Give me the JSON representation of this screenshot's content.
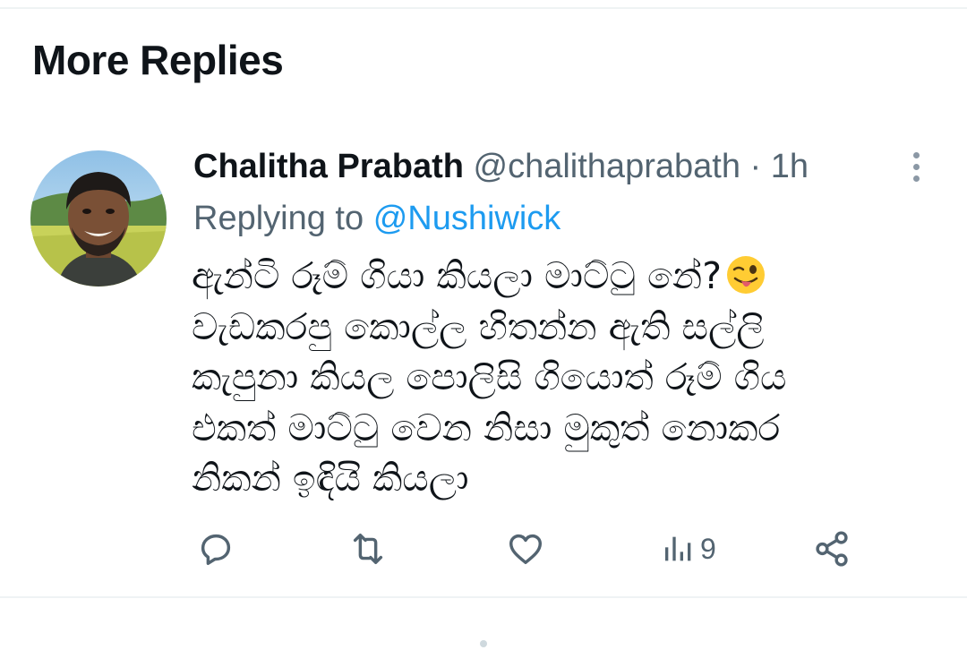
{
  "section": {
    "title": "More Replies"
  },
  "reply": {
    "author_name": "Chalitha Prabath",
    "author_handle": "@chalithaprabath",
    "separator": "·",
    "timestamp": "1h",
    "replying_prefix": "Replying to",
    "replying_to": "@Nushiwick",
    "body_lines": [
      "ඇන්ටි රූම් ගියා කියලා මාට්ටු නේ?",
      "වැඩකරපු කොල්ල හිතන්න ඇති සල්ලි",
      "කැපුනා කියල පොලිසි ගියොත් රූම් ගිය",
      "එකත් මාට්ටු වෙන නිසා මුකුත් නොකර",
      "නිකන් ඉඳියි කියලා"
    ],
    "emoji": "winking-face-with-tongue",
    "views_count": "9"
  },
  "icons": {
    "reply": "reply-bubble-icon",
    "retweet": "retweet-icon",
    "like": "heart-icon",
    "views": "views-bar-chart-icon",
    "share": "share-nodes-icon",
    "more": "more-vertical-icon"
  },
  "colors": {
    "text_primary": "#0f1419",
    "text_secondary": "#536471",
    "link_blue": "#1d9bf0",
    "divider": "#eff3f4"
  }
}
